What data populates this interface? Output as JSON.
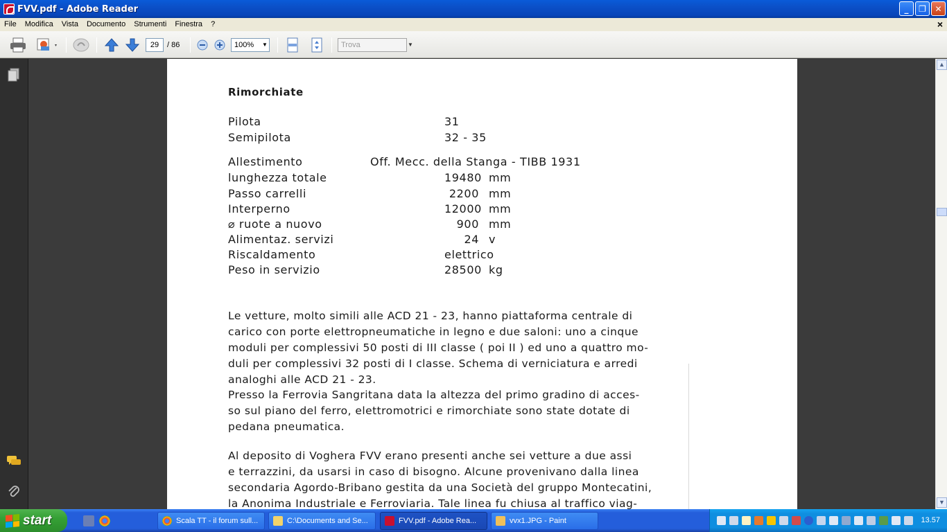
{
  "window": {
    "title": "FVV.pdf - Adobe Reader",
    "controls": [
      "_",
      "❐",
      "✕"
    ]
  },
  "menu": {
    "items": [
      "File",
      "Modifica",
      "Vista",
      "Documento",
      "Strumenti",
      "Finestra",
      "?"
    ],
    "close_glyph": "×"
  },
  "toolbar": {
    "page_current": "29",
    "page_total": "/ 86",
    "zoom": "100%",
    "find_placeholder": "Trova",
    "icons": [
      "print-icon",
      "review-icon",
      "hand-icon",
      "previous-page-icon",
      "next-page-icon",
      "zoom-out-icon",
      "zoom-in-icon",
      "fit-width-icon",
      "fit-page-icon"
    ]
  },
  "nav": {
    "icons": [
      "pages-icon",
      "comments-icon",
      "attachments-icon"
    ]
  },
  "document": {
    "heading": "Rimorchiate",
    "specs": [
      {
        "label": "Pilota",
        "value": "31",
        "unit": ""
      },
      {
        "label": "Semipilota",
        "value": "32 - 35",
        "unit": ""
      },
      {
        "label": "Allestimento",
        "value": "Off. Mecc. della Stanga - TIBB  1931",
        "unit": ""
      },
      {
        "label": "lunghezza totale",
        "value": "19480",
        "unit": "mm"
      },
      {
        "label": "Passo carrelli",
        "value": "2200",
        "unit": "mm"
      },
      {
        "label": "Interperno",
        "value": "12000",
        "unit": "mm"
      },
      {
        "label": "⌀ ruote a nuovo",
        "value": "900",
        "unit": "mm"
      },
      {
        "label": "Alimentaz. servizi",
        "value": "24",
        "unit": "v"
      },
      {
        "label": "Riscaldamento",
        "value": "elettrico",
        "unit": ""
      },
      {
        "label": "Peso in servizio",
        "value": "28500",
        "unit": "kg"
      }
    ],
    "paragraph_1": [
      "Le vetture, molto simili alle ACD 21 - 23, hanno piattaforma centrale di",
      "carico con porte elettropneumatiche in legno e due saloni: uno a cinque",
      "moduli per complessivi 50 posti di III classe ( poi II ) ed uno a quattro mo-",
      "duli per complessivi 32 posti di I classe. Schema di verniciatura e arredi",
      "analoghi alle ACD 21 - 23.",
      "Presso la Ferrovia Sangritana data la altezza del primo gradino di acces-",
      "so sul piano del ferro, elettromotrici e rimorchiate sono state dotate di",
      "pedana  pneumatica."
    ],
    "paragraph_2": [
      "Al deposito di Voghera FVV erano presenti anche sei vetture a due assi",
      "e terrazzini, da usarsi in caso di bisogno. Alcune provenivano dalla linea",
      "secondaria Agordo-Bribano gestita da una Società del gruppo Montecatini,",
      "la Anonima Industriale e Ferroviaria. Tale linea fu chiusa al traffico viag-"
    ]
  },
  "taskbar": {
    "start_label": "start",
    "tasks": [
      {
        "label": "Scala TT - il forum sull...",
        "color": "#e9b23a"
      },
      {
        "label": "C:\\Documents and Se...",
        "color": "#f2d36b"
      },
      {
        "label": "FVV.pdf - Adobe Rea...",
        "color": "#c8102e"
      },
      {
        "label": "vvx1.JPG - Paint",
        "color": "#f0c05a"
      }
    ],
    "clock": "13.57"
  },
  "colors": {
    "titlebar": "#0a5bd8",
    "taskbar": "#245edb",
    "start": "#35a035",
    "doc_background": "#3b3b3b"
  }
}
